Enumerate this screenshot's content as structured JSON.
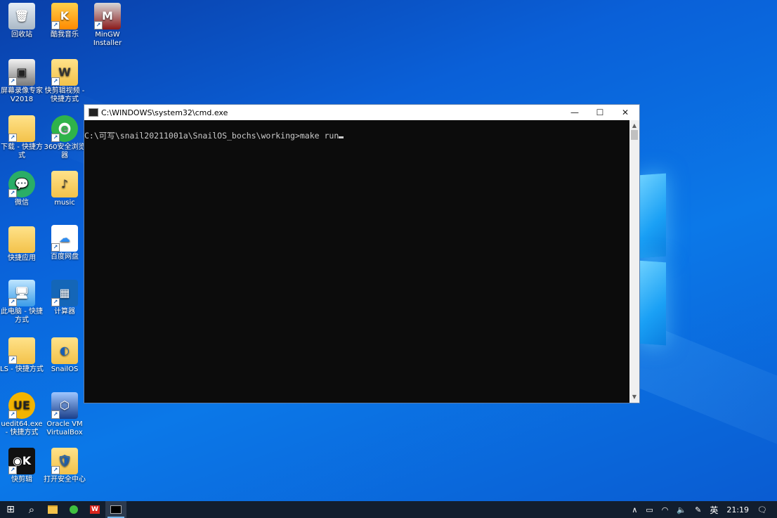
{
  "desktop": {
    "icons": [
      {
        "label": "回收站",
        "icon": "recycle-bin-icon"
      },
      {
        "label": "酷我音乐",
        "icon": "kuwo-music-icon"
      },
      {
        "label": "MinGW Installer",
        "icon": "mingw-installer-icon"
      },
      {
        "label": "屏幕录像专家 V2018",
        "icon": "screen-recorder-icon"
      },
      {
        "label": "快剪辑视频 - 快捷方式",
        "icon": "document-shortcut-icon"
      },
      {
        "label": "下载 - 快捷方式",
        "icon": "folder-icon"
      },
      {
        "label": "360安全浏览器",
        "icon": "browser-360-icon"
      },
      {
        "label": "微信",
        "icon": "wechat-icon"
      },
      {
        "label": "music",
        "icon": "music-folder-icon"
      },
      {
        "label": "快捷应用",
        "icon": "folder-icon"
      },
      {
        "label": "百度网盘",
        "icon": "baidu-netdisk-icon"
      },
      {
        "label": "此电脑 - 快捷方式",
        "icon": "this-pc-icon"
      },
      {
        "label": "计算器",
        "icon": "calculator-icon"
      },
      {
        "label": "LS - 快捷方式",
        "icon": "folder-icon"
      },
      {
        "label": "SnailOS",
        "icon": "snailos-folder-icon"
      },
      {
        "label": "uedit64.exe - 快捷方式",
        "icon": "ultraedit-icon"
      },
      {
        "label": "Oracle VM VirtualBox",
        "icon": "virtualbox-icon"
      },
      {
        "label": "快剪辑",
        "icon": "video-editor-icon"
      },
      {
        "label": "打开安全中心",
        "icon": "security-center-icon"
      }
    ]
  },
  "window": {
    "title": "C:\\WINDOWS\\system32\\cmd.exe",
    "minimize": "—",
    "maximize": "☐",
    "close": "✕",
    "console_line": "C:\\可写\\snail20211001a\\SnailOS_bochs\\working>make run"
  },
  "taskbar": {
    "start": "⊞",
    "search": "⌕",
    "tray": {
      "chevron": "∧",
      "ime": "英",
      "time": "21:19",
      "notifications": "🗨"
    }
  }
}
